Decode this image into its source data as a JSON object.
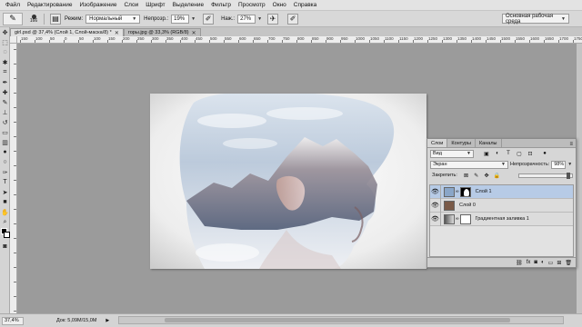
{
  "menu": [
    "Файл",
    "Редактирование",
    "Изображение",
    "Слои",
    "Шрифт",
    "Выделение",
    "Фильтр",
    "Просмотр",
    "Окно",
    "Справка"
  ],
  "options": {
    "brush_size": "166",
    "mode_label": "Режим:",
    "mode_value": "Нормальный",
    "opacity_label": "Непрозр.:",
    "opacity_value": "19%",
    "pressure_label": "Наж.:",
    "pressure_value": "27%",
    "workspace": "Основная рабочая среда"
  },
  "doc_tabs": [
    {
      "label": "girl.psd @ 37,4% (Слой 1, Слой-маска/8) *",
      "active": true
    },
    {
      "label": "горы.jpg @ 33,3% (RGB/8)",
      "active": false
    }
  ],
  "ruler_labels": [
    "150",
    "100",
    "50",
    "0",
    "50",
    "100",
    "150",
    "200",
    "250",
    "300",
    "350",
    "400",
    "450",
    "500",
    "550",
    "600",
    "650",
    "700",
    "750",
    "800",
    "850",
    "900",
    "950",
    "1000",
    "1050",
    "1100",
    "1150",
    "1200",
    "1250",
    "1300",
    "1350",
    "1400",
    "1450",
    "1500",
    "1550",
    "1600",
    "1650",
    "1700",
    "1750"
  ],
  "status": {
    "zoom": "37,4%",
    "doc": "Док: 5,09M/15,0M"
  },
  "layers_panel": {
    "tabs": [
      "Слои",
      "Контуры",
      "Каналы"
    ],
    "filter_value": "Вид",
    "blend_mode": "Экран",
    "opacity_label": "Непрозрачность:",
    "opacity_value": "98%",
    "lock_label": "Закрепить:",
    "fill_label": "Заливка:",
    "fill_value": "100%",
    "layers": [
      {
        "name": "Слой 1",
        "selected": true,
        "thumb_color": "#8aa6c8"
      },
      {
        "name": "Слой 0",
        "selected": false,
        "thumb_color": "#7a5a48"
      },
      {
        "name": "Градиентная заливка 1",
        "selected": false,
        "thumb_color": "#8c8c8c"
      }
    ]
  },
  "colors": {
    "canvas_bg": "#9b9b9b",
    "selected_layer": "#b7cbe6",
    "panel_bg": "#d6d6d6"
  }
}
